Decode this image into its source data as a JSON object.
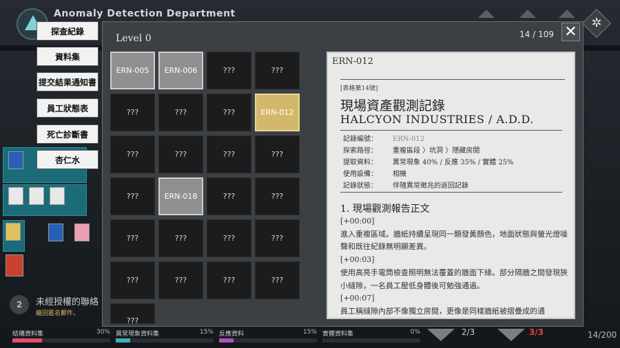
{
  "app": {
    "title": "Anomaly Detection Department"
  },
  "nav": {
    "items": [
      "探查紀錄",
      "資料集",
      "提交結果通知書",
      "員工狀態表",
      "死亡診斷書",
      "杏仁水"
    ]
  },
  "notification": {
    "count": "2",
    "title": "未經授權的聯絡",
    "subtitle": "繼回匿名郵件。"
  },
  "modal": {
    "level": "Level 0",
    "counter": "14 / 109",
    "close_glyph": "✕"
  },
  "grid": {
    "unknown_label": "???",
    "cells": [
      {
        "label": "ERN-005",
        "state": "known"
      },
      {
        "label": "ERN-006",
        "state": "known"
      },
      {
        "label": "???",
        "state": "unknown"
      },
      {
        "label": "???",
        "state": "unknown"
      },
      {
        "label": "???",
        "state": "unknown"
      },
      {
        "label": "???",
        "state": "unknown"
      },
      {
        "label": "???",
        "state": "unknown"
      },
      {
        "label": "ERN-012",
        "state": "selected"
      },
      {
        "label": "???",
        "state": "unknown"
      },
      {
        "label": "???",
        "state": "unknown"
      },
      {
        "label": "???",
        "state": "unknown"
      },
      {
        "label": "???",
        "state": "unknown"
      },
      {
        "label": "???",
        "state": "unknown"
      },
      {
        "label": "ERN-018",
        "state": "known"
      },
      {
        "label": "???",
        "state": "unknown"
      },
      {
        "label": "???",
        "state": "unknown"
      },
      {
        "label": "???",
        "state": "unknown"
      },
      {
        "label": "???",
        "state": "unknown"
      },
      {
        "label": "???",
        "state": "unknown"
      },
      {
        "label": "???",
        "state": "unknown"
      },
      {
        "label": "???",
        "state": "unknown"
      },
      {
        "label": "???",
        "state": "unknown"
      },
      {
        "label": "???",
        "state": "unknown"
      },
      {
        "label": "???",
        "state": "unknown"
      },
      {
        "label": "???",
        "state": "unknown"
      }
    ]
  },
  "document": {
    "code": "ERN-012",
    "form_no": "[表格第14號]",
    "title": "現場資產觀測記錄",
    "company": "HALCYON INDUSTRIES / A.D.D.",
    "fields": [
      {
        "key": "記錄編號：",
        "value": "ERN-012"
      },
      {
        "key": "探索路徑：",
        "value": "重複區段 〉坑洞 〉隱藏房間"
      },
      {
        "key": "提取資料：",
        "value": "異常現象 40% / 反應 35% / 實體 25%"
      },
      {
        "key": "使用設備：",
        "value": "相機"
      },
      {
        "key": "記錄狀態：",
        "value": "伴隨異常徵兆的返回記錄"
      }
    ],
    "section_title": "1. 現場觀測報告正文",
    "body": [
      "[+00:00]",
      "進入重複區域。牆紙持續呈現同一類發黃顏色，地面狀態與螢光燈噪聲和既往紀錄無明顯差異。",
      "[+00:03]",
      "使用高亮手電筒檢查照明無法覆蓋的牆面下緣。部分隔牆之間發現狹小縫隙，一名員工壓低身體後可勉強通過。",
      "[+00:07]",
      "員工稱縫隙內部不像獨立房間，更像是同樣牆紙被摺疊成的通"
    ]
  },
  "stats": [
    {
      "label": "結構資料集",
      "percent": "30%",
      "value": 0.3,
      "color": "#e0506a"
    },
    {
      "label": "異常現象資料集",
      "percent": "15%",
      "value": 0.15,
      "color": "#3fb0b8"
    },
    {
      "label": "反應資料",
      "percent": "15%",
      "value": 0.15,
      "color": "#b050c0"
    },
    {
      "label": "實體資料集",
      "percent": "0%",
      "value": 0.0,
      "color": "#d0a040"
    }
  ],
  "pager": {
    "page_a": "2/3",
    "page_b": "3/3",
    "total": "14/200"
  },
  "colors": {
    "accent": "#d2b86a",
    "danger": "#e04040"
  }
}
